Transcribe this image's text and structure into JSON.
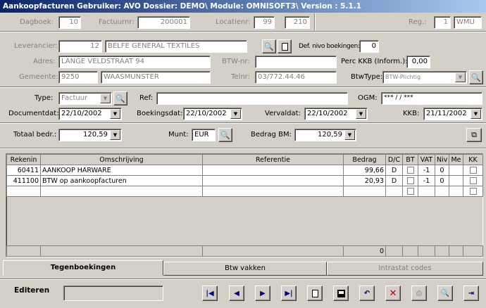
{
  "window": {
    "title": "Aankoopfacturen  Gebruiker: AVO  Dossier: DEMO\\  Module: OMNISOFT3\\  Version : 5.1.1"
  },
  "header": {
    "dagboek_label": "Dagboek:",
    "dagboek": "10",
    "factuurnr_label": "Factuurnr:",
    "factuurnr": "200001",
    "locatienr_label": "Locatienr:",
    "locatienr_a": "99",
    "locatienr_b": "210",
    "reg_label": "Reg.:",
    "reg_nr": "1",
    "reg_code": "WMU"
  },
  "supplier": {
    "leverancier_label": "Leverancier:",
    "leverancier_nr": "12",
    "leverancier_naam": "BELFE GENERAL TEXTILES",
    "def_niveau_label": "Def. nivo boekingen:",
    "def_niveau": "0",
    "adres_label": "Adres:",
    "adres": "LANGE VELDSTRAAT 94",
    "btwnr_label": "BTW-nr:",
    "btwnr": "",
    "perc_kkb_label": "Perc KKB (Inform.):",
    "perc_kkb": "0,00",
    "gemeente_label": "Gemeente:",
    "postcode": "9250",
    "gemeente": "WAASMUNSTER",
    "telnr_label": "Telnr:",
    "telnr": "03/772.44.46",
    "btwtype_label": "BtwType:",
    "btwtype": "BTW-Plichtig"
  },
  "doc": {
    "type_label": "Type:",
    "type": "Factuur",
    "ref_label": "Ref:",
    "ref": "",
    "ogm_label": "OGM:",
    "ogm": "***  /  /  ***",
    "documentdat_label": "Documentdat:",
    "documentdat": "22/10/2002",
    "boekingsdat_label": "Boekingsdat:",
    "boekingsdat": "22/10/2002",
    "vervaldat_label": "Vervaldat:",
    "vervaldat": "22/10/2002",
    "kkb_label": "KKB:",
    "kkb": "21/11/2002"
  },
  "totals": {
    "totaal_label": "Totaal bedr.:",
    "totaal": "120,59",
    "munt_label": "Munt:",
    "munt": "EUR",
    "bedrag_bm_label": "Bedrag BM:",
    "bedrag_bm": "120,59"
  },
  "table": {
    "headers": [
      "Rekenin",
      "Omschrijving",
      "Referentie",
      "Bedrag",
      "D/C",
      "BT",
      "VAT",
      "Niv",
      "Me",
      "KK"
    ],
    "rows": [
      [
        "60411",
        "AANKOOP HARWARE",
        "",
        "99,66",
        "D",
        "",
        "-1",
        "0",
        "",
        ""
      ],
      [
        "411100",
        "BTW op aankoopfacturen",
        "",
        "20,93",
        "D",
        "",
        "-1",
        "0",
        "",
        ""
      ],
      [
        "",
        "",
        "",
        "",
        "",
        "",
        "",
        "",
        "",
        ""
      ]
    ],
    "footer_total": "0"
  },
  "tabs": [
    "Tegenboekingen",
    "Btw vakken",
    "Intrastat codes"
  ],
  "status": {
    "mode": "Editeren",
    "field": ""
  }
}
